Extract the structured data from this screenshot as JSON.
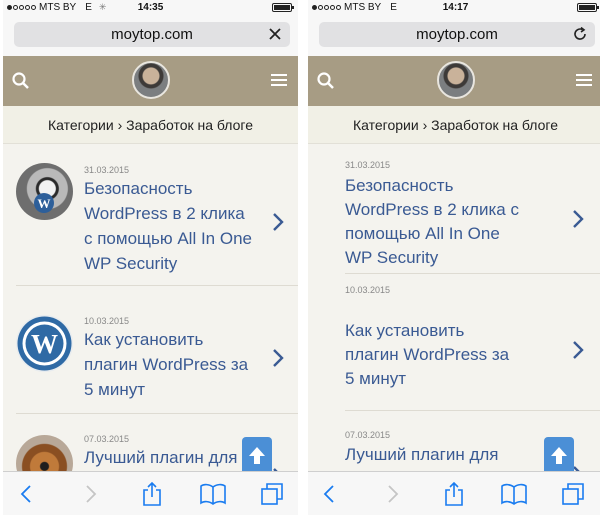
{
  "screens": [
    {
      "status": {
        "carrier": "MTS BY",
        "network": "E",
        "time": "14:35",
        "battery_level": 0.9
      },
      "url": "moytop.com",
      "url_action_icon": "close-icon",
      "breadcrumb": "Категории › Заработок на блоге",
      "posts": [
        {
          "date": "31.03.2015",
          "title_lines": [
            "Безопасность",
            "WordPress в 2 клика",
            "с помощью All In One",
            "WP Security"
          ],
          "thumb": "wordpress-security-lock"
        },
        {
          "date": "10.03.2015",
          "title_lines": [
            "Как установить",
            "плагин WordPress за",
            "5 минут"
          ],
          "thumb": "wordpress-logo"
        },
        {
          "date": "07.03.2015",
          "title_lines": [
            "Лучший плагин для"
          ],
          "thumb": "dog"
        }
      ]
    },
    {
      "status": {
        "carrier": "MTS BY",
        "network": "E",
        "time": "14:17",
        "battery_level": 0.9
      },
      "url": "moytop.com",
      "url_action_icon": "reload-icon",
      "breadcrumb": "Категории › Заработок на блоге",
      "posts": [
        {
          "date": "31.03.2015",
          "title_lines": [
            "Безопасность",
            "WordPress в 2 клика с",
            "помощью All In One",
            "WP Security"
          ]
        },
        {
          "date": "10.03.2015",
          "title_lines": [
            "Как установить",
            "плагин WordPress за",
            "5 минут"
          ]
        },
        {
          "date": "07.03.2015",
          "title_lines": [
            "Лучший плагин для"
          ]
        }
      ]
    }
  ],
  "colors": {
    "header_bg": "#a79c84",
    "breadcrumb_bg": "#f1f0e6",
    "link": "#3a5a93",
    "accent": "#4b8fd6",
    "ios_blue": "#1a7cf0"
  },
  "icons": {
    "search": "search-icon",
    "menu": "hamburger-menu-icon",
    "back": "back-chevron-icon",
    "forward": "forward-chevron-icon",
    "share": "share-icon",
    "bookmarks": "bookmarks-icon",
    "tabs": "tabs-icon",
    "scroll_top": "arrow-up-icon",
    "chevron": "chevron-right-icon"
  }
}
